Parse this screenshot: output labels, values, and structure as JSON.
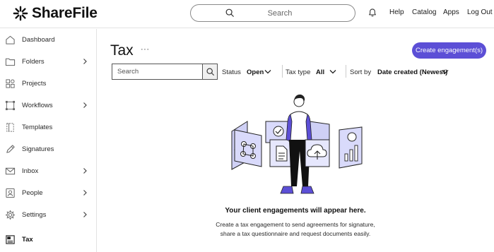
{
  "app": {
    "logo_text": "ShareFile",
    "brand_color": "#5c4fd6"
  },
  "header": {
    "search_placeholder": "Search",
    "nav": {
      "help": "Help",
      "catalog": "Catalog",
      "apps": "Apps",
      "logout": "Log Out"
    }
  },
  "sidebar": {
    "items": [
      {
        "label": "Dashboard",
        "icon": "home-icon",
        "has_chevron": false
      },
      {
        "label": "Folders",
        "icon": "folder-icon",
        "has_chevron": true
      },
      {
        "label": "Projects",
        "icon": "projects-icon",
        "has_chevron": false
      },
      {
        "label": "Workflows",
        "icon": "workflows-icon",
        "has_chevron": true
      },
      {
        "label": "Templates",
        "icon": "templates-icon",
        "has_chevron": false
      },
      {
        "label": "Signatures",
        "icon": "pen-icon",
        "has_chevron": false
      },
      {
        "label": "Inbox",
        "icon": "mail-icon",
        "has_chevron": true
      },
      {
        "label": "People",
        "icon": "person-icon",
        "has_chevron": true
      },
      {
        "label": "Settings",
        "icon": "gear-icon",
        "has_chevron": true
      },
      {
        "label": "Tax",
        "icon": "tax-icon",
        "has_chevron": false,
        "active": true
      }
    ]
  },
  "main": {
    "title": "Tax",
    "more_label": "···",
    "create_button": "Create engagement(s)",
    "search_placeholder": "Search",
    "filters": {
      "status_label": "Status",
      "status_value": "Open",
      "taxtype_label": "Tax type",
      "taxtype_value": "All",
      "sort_label": "Sort by",
      "sort_value": "Date created (Newest)"
    },
    "empty_state": {
      "title": "Your client engagements will appear here.",
      "line1": "Create a tax engagement to send agreements for signature,",
      "line2": "share a tax questionnaire and request documents easily."
    }
  }
}
